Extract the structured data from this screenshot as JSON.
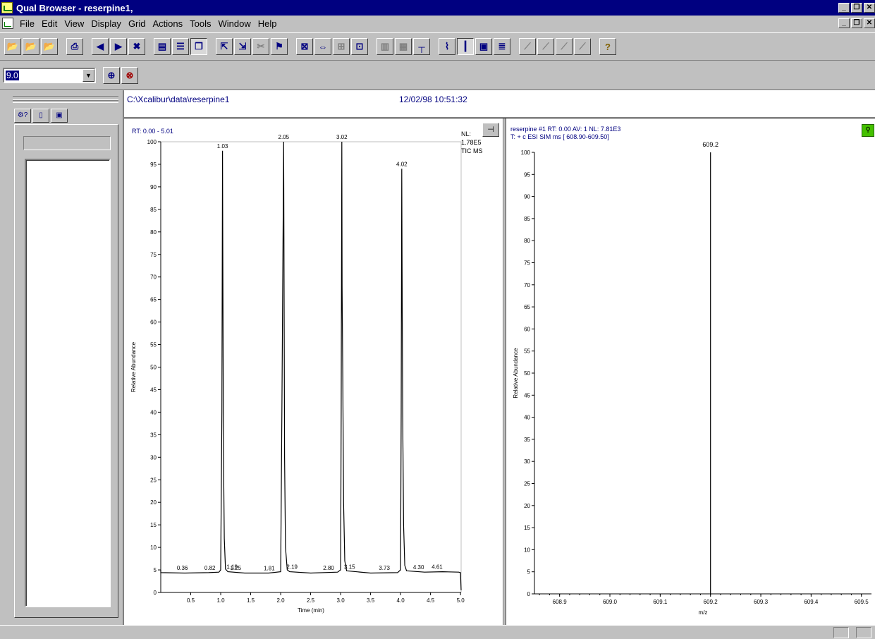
{
  "window": {
    "title": "Qual Browser - reserpine1,"
  },
  "menu": {
    "items": [
      {
        "label": "File"
      },
      {
        "label": "Edit"
      },
      {
        "label": "View"
      },
      {
        "label": "Display"
      },
      {
        "label": "Grid"
      },
      {
        "label": "Actions"
      },
      {
        "label": "Tools"
      },
      {
        "label": "Window"
      },
      {
        "label": "Help"
      }
    ]
  },
  "toolbar": {
    "icons": [
      "open-icon",
      "open-raw-icon",
      "open-layout-icon",
      "print-icon",
      "prev-icon",
      "next-icon",
      "close-view-icon",
      "tile-icon",
      "stack-icon",
      "cascade-icon",
      "insert-cell-left-icon",
      "insert-cell-below-icon",
      "delete-cell-icon",
      "pin-cell-icon",
      "zoom-all-icon",
      "zoom-x-icon",
      "zoom-y-icon",
      "reset-zoom-icon",
      "spectrum-list-icon",
      "library-icon",
      "peak-detect-icon",
      "chromatogram-view-icon",
      "spectrum-view-icon",
      "map-view-icon",
      "spec-list-icon",
      "normalize-icon",
      "stack-plots-icon",
      "show-peaks-icon",
      "hide-peaks-icon",
      "help-icon"
    ]
  },
  "toolbar2": {
    "zoom_value": "9.0",
    "icons": [
      "auto-range-icon",
      "clear-range-icon"
    ]
  },
  "document": {
    "path": "C:\\Xcalibur\\data\\reserpine1",
    "datetime": "12/02/98 10:51:32"
  },
  "chromatogram": {
    "header_rt": "RT: 0.00 - 5.01",
    "nl_label": "NL:",
    "nl_value": "1.78E5",
    "scan_filter": "TIC MS"
  },
  "spectrum": {
    "header_line1": "reserpine #1 RT: 0.00 AV: 1 NL: 7.81E3",
    "header_line2": "T: + c ESI SIM ms [ 608.90-609.50]"
  },
  "chart_data": [
    {
      "type": "line",
      "title": "",
      "xlabel": "Time (min)",
      "ylabel": "Relative Abundance",
      "xlim": [
        0.0,
        5.01
      ],
      "ylim": [
        0,
        100
      ],
      "x_ticks": [
        0.5,
        1.0,
        1.5,
        2.0,
        2.5,
        3.0,
        3.5,
        4.0,
        4.5,
        5.0
      ],
      "y_ticks": [
        0,
        5,
        10,
        15,
        20,
        25,
        30,
        35,
        40,
        45,
        50,
        55,
        60,
        65,
        70,
        75,
        80,
        85,
        90,
        95,
        100
      ],
      "grid": false,
      "series": [
        {
          "points": [
            [
              0.0,
              5
            ],
            [
              0.0,
              4.4
            ],
            [
              0.4,
              4.3
            ],
            [
              0.8,
              4.4
            ],
            [
              0.97,
              4.5
            ],
            [
              1.0,
              5
            ],
            [
              1.02,
              40
            ],
            [
              1.03,
              98
            ],
            [
              1.035,
              76
            ],
            [
              1.045,
              32
            ],
            [
              1.06,
              12
            ],
            [
              1.08,
              5.2
            ],
            [
              1.12,
              4.6
            ],
            [
              1.4,
              4.3
            ],
            [
              1.8,
              4.3
            ],
            [
              2.0,
              4.6
            ],
            [
              2.02,
              40
            ],
            [
              2.05,
              100
            ],
            [
              2.055,
              79
            ],
            [
              2.065,
              30
            ],
            [
              2.08,
              10
            ],
            [
              2.11,
              5
            ],
            [
              2.15,
              4.6
            ],
            [
              2.5,
              4.3
            ],
            [
              2.95,
              4.5
            ],
            [
              3.0,
              5
            ],
            [
              3.01,
              40
            ],
            [
              3.02,
              100
            ],
            [
              3.025,
              68
            ],
            [
              3.035,
              49
            ],
            [
              3.05,
              20
            ],
            [
              3.07,
              7
            ],
            [
              3.1,
              4.8
            ],
            [
              3.5,
              4.3
            ],
            [
              3.95,
              4.4
            ],
            [
              4.0,
              5
            ],
            [
              4.01,
              40
            ],
            [
              4.02,
              94
            ],
            [
              4.025,
              75
            ],
            [
              4.035,
              40
            ],
            [
              4.05,
              15
            ],
            [
              4.07,
              6
            ],
            [
              4.1,
              4.8
            ],
            [
              4.4,
              4.5
            ],
            [
              4.7,
              4.6
            ],
            [
              4.97,
              4.5
            ],
            [
              5.0,
              4.4
            ],
            [
              5.01,
              0.5
            ]
          ]
        }
      ],
      "peak_labels": [
        {
          "x": 1.03,
          "y": 98,
          "text": "1.03"
        },
        {
          "x": 2.05,
          "y": 100,
          "text": "2.05"
        },
        {
          "x": 3.02,
          "y": 100,
          "text": "3.02"
        },
        {
          "x": 4.02,
          "y": 94,
          "text": "4.02"
        },
        {
          "x": 0.36,
          "y": 4.4,
          "text": "0.36"
        },
        {
          "x": 0.82,
          "y": 4.4,
          "text": "0.82"
        },
        {
          "x": 1.19,
          "y": 4.6,
          "text": "1.19"
        },
        {
          "x": 1.25,
          "y": 4.4,
          "text": "1.25"
        },
        {
          "x": 1.81,
          "y": 4.3,
          "text": "1.81"
        },
        {
          "x": 2.19,
          "y": 4.6,
          "text": "2.19"
        },
        {
          "x": 2.8,
          "y": 4.4,
          "text": "2.80"
        },
        {
          "x": 3.15,
          "y": 4.6,
          "text": "3.15"
        },
        {
          "x": 3.73,
          "y": 4.4,
          "text": "3.73"
        },
        {
          "x": 4.3,
          "y": 4.5,
          "text": "4.30"
        },
        {
          "x": 4.61,
          "y": 4.6,
          "text": "4.61"
        }
      ]
    },
    {
      "type": "bar",
      "title": "",
      "xlabel": "m/z",
      "ylabel": "Relative Abundance",
      "xlim": [
        608.85,
        609.52
      ],
      "ylim": [
        0,
        100
      ],
      "x_ticks": [
        608.9,
        609.0,
        609.1,
        609.2,
        609.3,
        609.4,
        609.5
      ],
      "y_ticks": [
        0,
        5,
        10,
        15,
        20,
        25,
        30,
        35,
        40,
        45,
        50,
        55,
        60,
        65,
        70,
        75,
        80,
        85,
        90,
        95,
        100
      ],
      "grid": false,
      "peaks": [
        {
          "x": 609.2,
          "y": 100,
          "label": "609.2"
        }
      ]
    }
  ]
}
